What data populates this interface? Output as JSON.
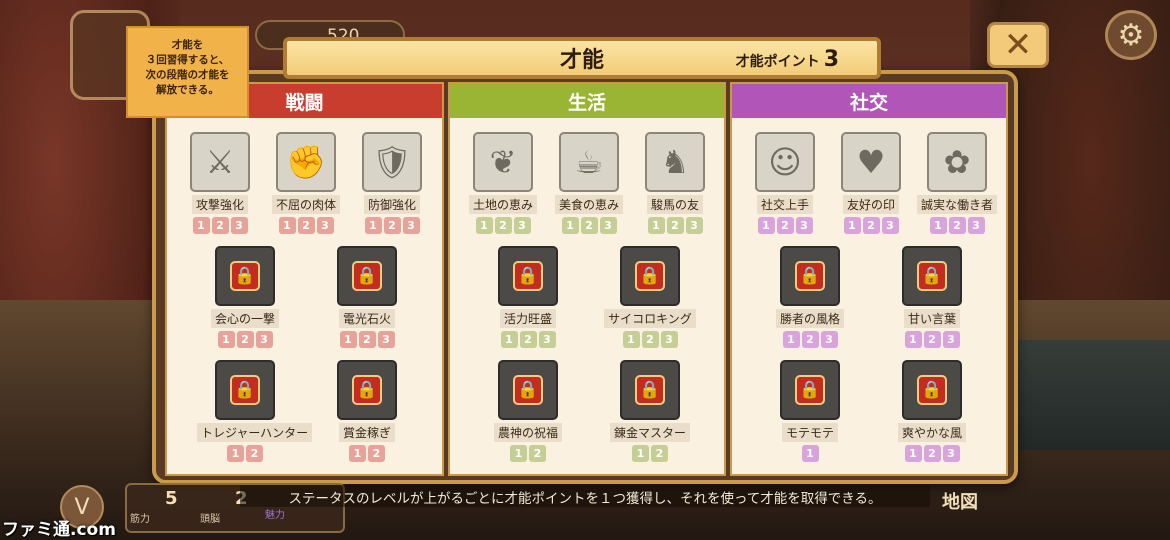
{
  "hud": {
    "gold": "520",
    "stat1_value": "5",
    "stat1_label": "筋力",
    "stat2_value": "2",
    "stat2_label": "頭脳",
    "stat3_label": "魅力",
    "map_label": "地図",
    "toggle_label": "V"
  },
  "tooltip": {
    "text": "才能を\n３回習得すると、\n次の段階の才能を\n解放できる。"
  },
  "panel": {
    "title": "才能",
    "points_label": "才能ポイント",
    "points_value": "3"
  },
  "columns": {
    "battle": {
      "label": "戦闘"
    },
    "life": {
      "label": "生活"
    },
    "social": {
      "label": "社交"
    }
  },
  "talents": {
    "battle": [
      {
        "name": "攻撃強化",
        "levels": [
          "1",
          "2",
          "3"
        ]
      },
      {
        "name": "不屈の肉体",
        "levels": [
          "1",
          "2",
          "3"
        ]
      },
      {
        "name": "防御強化",
        "levels": [
          "1",
          "2",
          "3"
        ]
      },
      {
        "name": "会心の一撃",
        "levels": [
          "1",
          "2",
          "3"
        ]
      },
      {
        "name": "電光石火",
        "levels": [
          "1",
          "2",
          "3"
        ]
      },
      {
        "name": "トレジャーハンター",
        "levels": [
          "1",
          "2"
        ]
      },
      {
        "name": "賞金稼ぎ",
        "levels": [
          "1",
          "2"
        ]
      }
    ],
    "life": [
      {
        "name": "土地の恵み",
        "levels": [
          "1",
          "2",
          "3"
        ]
      },
      {
        "name": "美食の恵み",
        "levels": [
          "1",
          "2",
          "3"
        ]
      },
      {
        "name": "駿馬の友",
        "levels": [
          "1",
          "2",
          "3"
        ]
      },
      {
        "name": "活力旺盛",
        "levels": [
          "1",
          "2",
          "3"
        ]
      },
      {
        "name": "サイコロキング",
        "levels": [
          "1",
          "2",
          "3"
        ]
      },
      {
        "name": "農神の祝福",
        "levels": [
          "1",
          "2"
        ]
      },
      {
        "name": "錬金マスター",
        "levels": [
          "1",
          "2"
        ]
      }
    ],
    "social": [
      {
        "name": "社交上手",
        "levels": [
          "1",
          "2",
          "3"
        ]
      },
      {
        "name": "友好の印",
        "levels": [
          "1",
          "2",
          "3"
        ]
      },
      {
        "name": "誠実な働き者",
        "levels": [
          "1",
          "2",
          "3"
        ]
      },
      {
        "name": "勝者の風格",
        "levels": [
          "1",
          "2",
          "3"
        ]
      },
      {
        "name": "甘い言葉",
        "levels": [
          "1",
          "2",
          "3"
        ]
      },
      {
        "name": "モテモテ",
        "levels": [
          "1"
        ]
      },
      {
        "name": "爽やかな風",
        "levels": [
          "1",
          "2",
          "3"
        ]
      }
    ]
  },
  "footer": {
    "text": "ステータスのレベルが上がるごとに才能ポイントを１つ獲得し、それを使って才能を取得できる。"
  },
  "watermark": "ファミ通.com"
}
